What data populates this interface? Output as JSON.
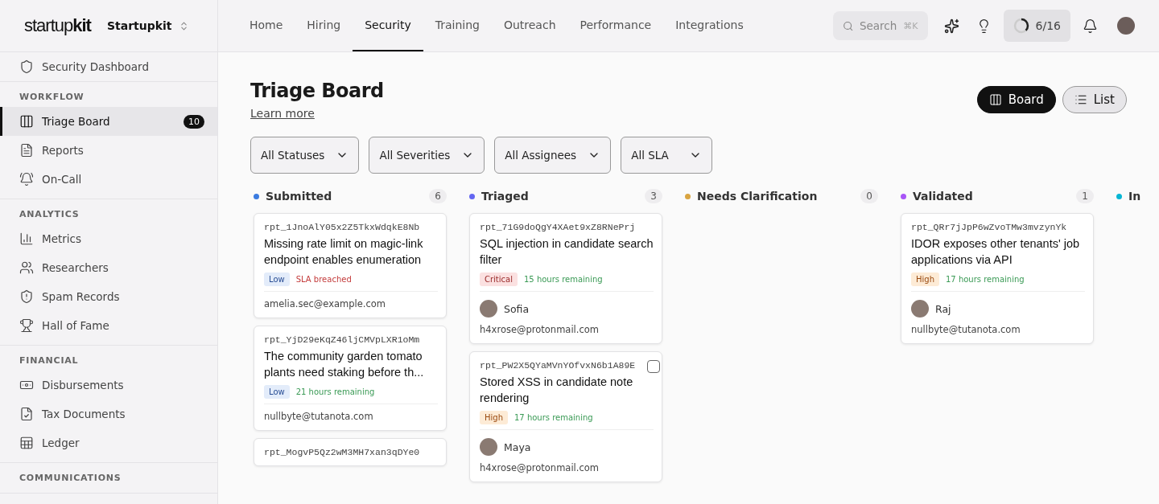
{
  "brand": {
    "logo_light": "startup",
    "logo_bold": "kit",
    "workspace": "Startupkit"
  },
  "nav": [
    {
      "label": "Home",
      "selected": false
    },
    {
      "label": "Hiring",
      "selected": false
    },
    {
      "label": "Security",
      "selected": true
    },
    {
      "label": "Training",
      "selected": false
    },
    {
      "label": "Outreach",
      "selected": false
    },
    {
      "label": "Performance",
      "selected": false
    },
    {
      "label": "Integrations",
      "selected": false
    }
  ],
  "search": {
    "placeholder": "Search",
    "shortcut": "⌘K"
  },
  "progress": {
    "label": "6/16",
    "level": 0.375
  },
  "sidebar": {
    "top": {
      "label": "Security Dashboard"
    },
    "sections": [
      {
        "title": "WORKFLOW",
        "items": [
          {
            "label": "Triage Board",
            "badge": "10",
            "selected": true
          },
          {
            "label": "Reports",
            "selected": false
          },
          {
            "label": "On-Call",
            "selected": false
          }
        ]
      },
      {
        "title": "ANALYTICS",
        "items": [
          {
            "label": "Metrics",
            "selected": false
          },
          {
            "label": "Researchers",
            "selected": false
          },
          {
            "label": "Spam Records",
            "selected": false
          },
          {
            "label": "Hall of Fame",
            "selected": false
          }
        ]
      },
      {
        "title": "FINANCIAL",
        "items": [
          {
            "label": "Disbursements",
            "selected": false
          },
          {
            "label": "Tax Documents",
            "selected": false
          },
          {
            "label": "Ledger",
            "selected": false
          }
        ]
      },
      {
        "title": "COMMUNICATIONS"
      }
    ]
  },
  "page": {
    "title": "Triage Board",
    "link": "Learn more"
  },
  "views": [
    {
      "label": "Board",
      "selected": true
    },
    {
      "label": "List",
      "selected": false
    }
  ],
  "filters": [
    "All Statuses",
    "All Severities",
    "All Assignees",
    "All SLA"
  ],
  "columns": [
    {
      "title": "Submitted",
      "color": "#3b7be0",
      "count": "6",
      "cards": [
        {
          "id": "rpt_1JnoAlY05x2Z5TkxWdqkE8Nb",
          "title": "Missing rate limit on magic-link endpoint enables enumeration",
          "severity": {
            "kind": "low",
            "label": "Low"
          },
          "sla": {
            "kind": "breached",
            "label": "SLA breached"
          },
          "email": "amelia.sec@example.com"
        },
        {
          "id": "rpt_YjD29eKqZ46ljCMVpLXR1oMm",
          "title": "The community garden tomato plants need staking before th...",
          "severity": {
            "kind": "low",
            "label": "Low"
          },
          "sla": {
            "kind": "ok",
            "label": "21 hours remaining"
          },
          "email": "nullbyte@tutanota.com"
        },
        {
          "id": "rpt_MogvP5Qz2wM3MH7xan3qDYe0"
        }
      ]
    },
    {
      "title": "Triaged",
      "color": "#6366f1",
      "count": "3",
      "cards": [
        {
          "id": "rpt_71G9doQgY4XAet9xZ8RNePrj",
          "title": "SQL injection in candidate search filter",
          "severity": {
            "kind": "critical",
            "label": "Critical"
          },
          "sla": {
            "kind": "ok",
            "label": "15 hours remaining"
          },
          "assignee": "Sofia",
          "email": "h4xrose@protonmail.com"
        },
        {
          "id": "rpt_PW2X5QYaMVnYOfvxN6b1A89E",
          "checked": false,
          "title": "Stored XSS in candidate note rendering",
          "severity": {
            "kind": "high",
            "label": "High"
          },
          "sla": {
            "kind": "ok",
            "label": "17 hours remaining"
          },
          "assignee": "Maya",
          "email": "h4xrose@protonmail.com"
        }
      ]
    },
    {
      "title": "Needs Clarification",
      "color": "#d9a441",
      "count": "0"
    },
    {
      "title": "Validated",
      "color": "#a855f7",
      "count": "1",
      "cards": [
        {
          "id": "rpt_QRr7jJpP6wZvoTMw3mvzynYk",
          "title": "IDOR exposes other tenants' job applications via API",
          "severity": {
            "kind": "high",
            "label": "High"
          },
          "sla": {
            "kind": "ok",
            "label": "17 hours remaining"
          },
          "assignee": "Raj",
          "email": "nullbyte@tutanota.com"
        }
      ]
    },
    {
      "title": "In",
      "color": "#06b6d4"
    }
  ]
}
